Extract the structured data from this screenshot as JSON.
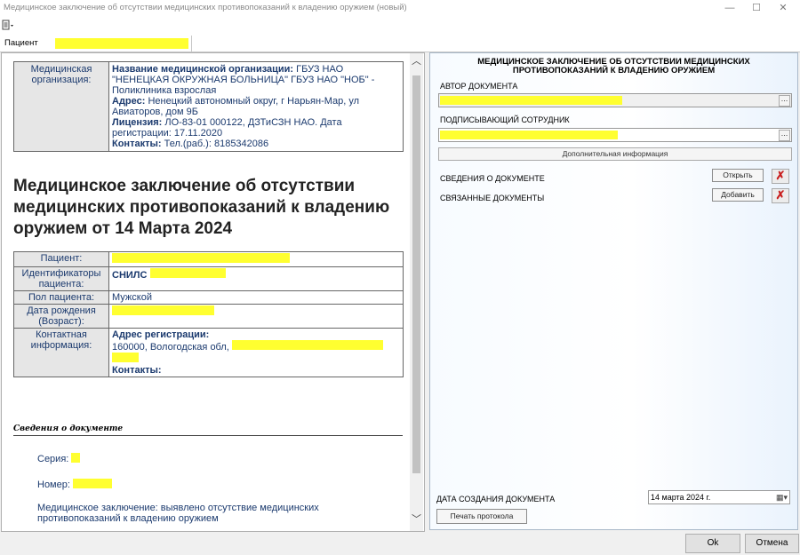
{
  "window": {
    "title": "Медицинское заключение об отсутствии медицинских противопоказаний к владению оружием (новый)",
    "minimize": "—",
    "maximize": "☐",
    "close": "✕"
  },
  "tab": {
    "label": "Пациент"
  },
  "org": {
    "label": "Медицинская организация:",
    "name_label": "Название медицинской организации:",
    "name_value": " ГБУЗ НАО \"НЕНЕЦКАЯ ОКРУЖНАЯ БОЛЬНИЦА\" ГБУЗ НАО \"НОБ\" - Поликлиника взрослая",
    "address_label": "Адрес:",
    "address_value": " Ненецкий автономный округ, г Нарьян-Мар, ул Авиаторов, дом 9Б",
    "license_label": "Лицензия:",
    "license_value": " ЛО-83-01 000122, ДЗТиСЗН НАО. Дата регистрации: 17.11.2020",
    "contacts_label": "Контакты:",
    "contacts_value": " Тел.(раб.): 8185342086"
  },
  "doc_title": "Медицинское заключение об отсутствии медицинских противопоказаний к владению оружием от 14 Марта 2024",
  "patient": {
    "name_label": "Пациент:",
    "ids_label": "Идентификаторы пациента:",
    "snils_label": "СНИЛС",
    "gender_label": "Пол пациента:",
    "gender_value": "Мужской",
    "birth_label": "Дата рождения (Возраст):",
    "contact_label": "Контактная информация:",
    "reg_address_label": "Адрес регистрации:",
    "reg_address_value": "160000, Вологодская обл,",
    "contacts_label": "Контакты:"
  },
  "doc_info": {
    "header": "Сведения о документе",
    "series_label": "Серия:",
    "number_label": "Номер:",
    "conclusion": "Медицинское заключение: выявлено отсутствие медицинских противопоказаний к владению оружием"
  },
  "right": {
    "title": "МЕДИЦИНСКОЕ ЗАКЛЮЧЕНИЕ ОБ ОТСУТСТВИИ МЕДИЦИНСКИХ ПРОТИВОПОКАЗАНИЙ К ВЛАДЕНИЮ ОРУЖИЕМ",
    "author_label": "АВТОР ДОКУМЕНТА",
    "signer_label": "ПОДПИСЫВАЮЩИЙ СОТРУДНИК",
    "additional_info": "Дополнительная информация",
    "doc_info_label": "СВЕДЕНИЯ О ДОКУМЕНТЕ",
    "open_button": "Открыть",
    "linked_docs_label": "СВЯЗАННЫЕ ДОКУМЕНТЫ",
    "add_button": "Добавить",
    "created_label": "ДАТА СОЗДАНИЯ ДОКУМЕНТА",
    "created_value": "14  марта  2024 г.",
    "print_button": "Печать протокола"
  },
  "footer": {
    "ok": "Ok",
    "cancel": "Отмена"
  },
  "colors": {
    "highlight": "#ffff30",
    "link_text": "#1b3a6e"
  }
}
